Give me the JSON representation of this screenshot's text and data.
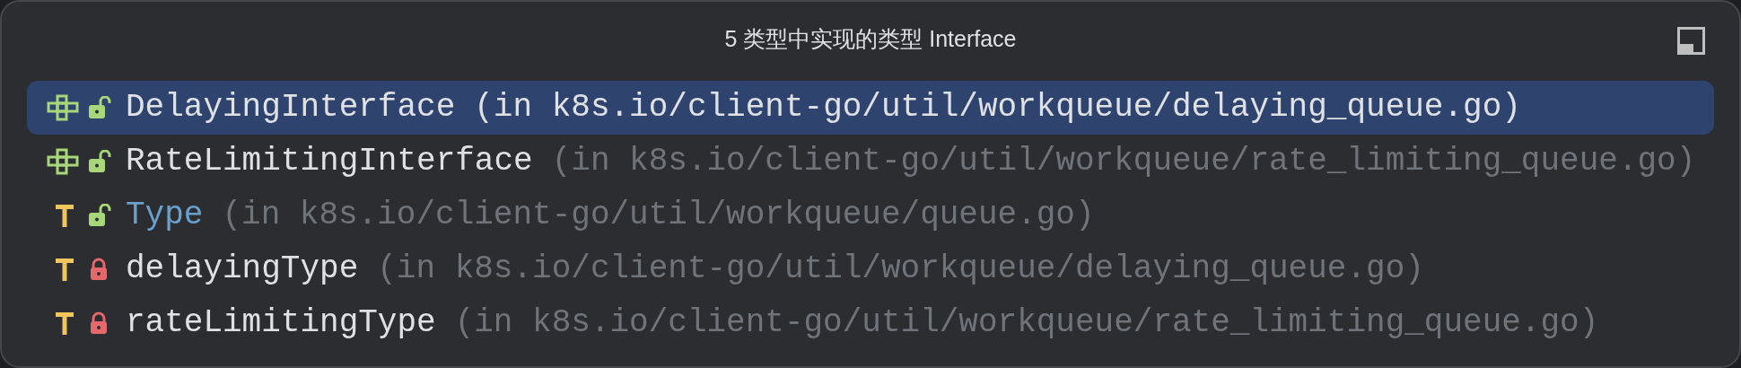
{
  "popup": {
    "title": "5 类型中实现的类型 Interface"
  },
  "items": [
    {
      "kind": "interface",
      "public": true,
      "name": "DelayingInterface",
      "location": "(in k8s.io/client-go/util/workqueue/delaying_queue.go)",
      "selected": true,
      "highlighted": false
    },
    {
      "kind": "interface",
      "public": true,
      "name": "RateLimitingInterface",
      "location": "(in k8s.io/client-go/util/workqueue/rate_limiting_queue.go)",
      "selected": false,
      "highlighted": false
    },
    {
      "kind": "type",
      "public": true,
      "name": "Type",
      "location": "(in k8s.io/client-go/util/workqueue/queue.go)",
      "selected": false,
      "highlighted": true
    },
    {
      "kind": "type",
      "public": false,
      "name": "delayingType",
      "location": "(in k8s.io/client-go/util/workqueue/delaying_queue.go)",
      "selected": false,
      "highlighted": false
    },
    {
      "kind": "type",
      "public": false,
      "name": "rateLimitingType",
      "location": "(in k8s.io/client-go/util/workqueue/rate_limiting_queue.go)",
      "selected": false,
      "highlighted": false
    }
  ]
}
